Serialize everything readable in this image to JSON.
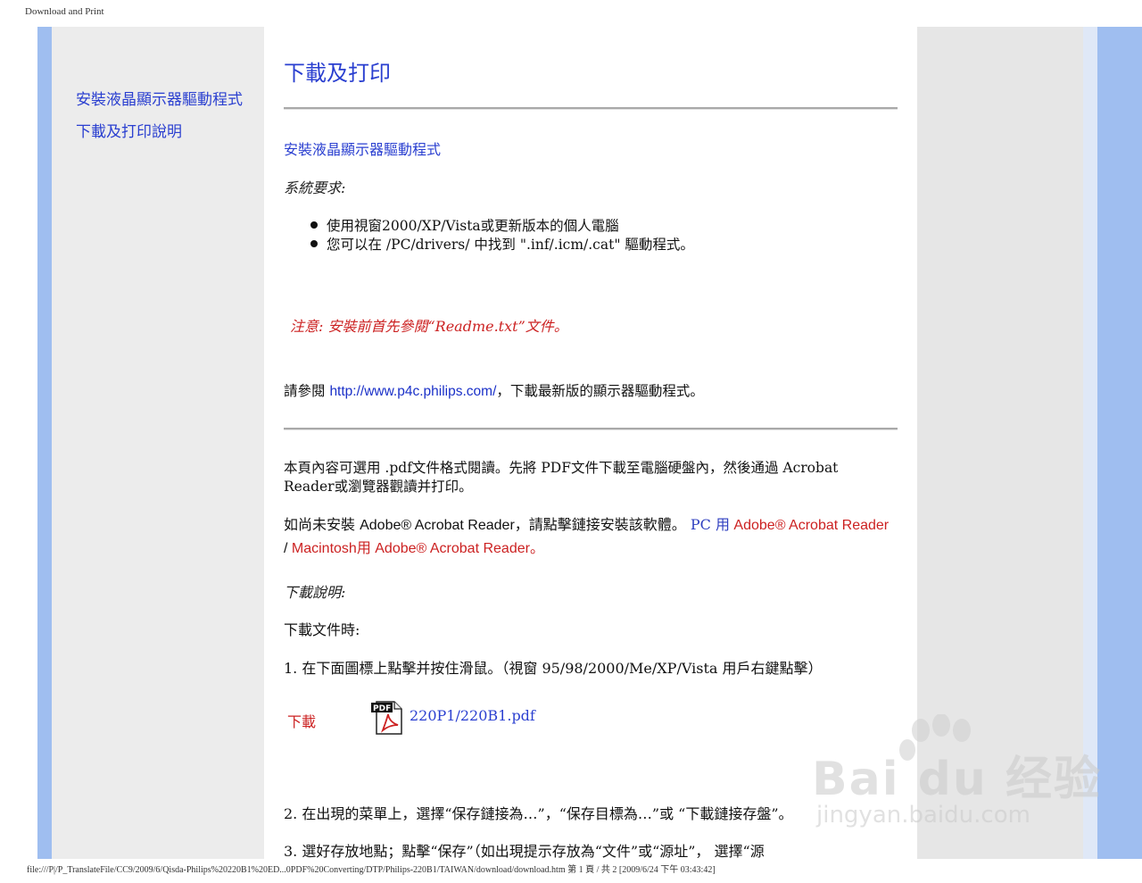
{
  "header": {
    "title": "Download and Print"
  },
  "sidebar": {
    "items": [
      {
        "label": "安裝液晶顯示器驅動程式"
      },
      {
        "label": "下載及打印說明"
      }
    ]
  },
  "main": {
    "title": "下載及打印",
    "driver_section_title": "安裝液晶顯示器驅動程式",
    "system_req_label": "系統要求:",
    "requirements": [
      "使用視窗2000/XP/Vista或更新版本的個人電腦",
      "您可以在 /PC/drivers/ 中找到 \".inf/.icm/.cat\" 驅動程式。"
    ],
    "note": "注意: 安裝前首先參閱“Readme.txt”文件。",
    "visit_prefix": "請參閱 ",
    "visit_url": "http://www.p4c.philips.com/",
    "visit_suffix": "，下載最新版的顯示器驅動程式。",
    "pdf_para": "本頁內容可選用 .pdf文件格式閱讀。先將 PDF文件下載至電腦硬盤內，然後通過 Acrobat Reader或瀏覽器觀讀并打印。",
    "acrobat": {
      "prefix": "如尚未安裝 ",
      "product": "Adobe® Acrobat Reader",
      "middle": "，請點擊鏈接安裝該軟體。 ",
      "pc_label": "PC 用",
      "pc_link": " Adobe® Acrobat Reader",
      "sep": " / ",
      "mac_link": "Macintosh用 Adobe® Acrobat Reader",
      "end": "。"
    },
    "download_instr_label": "下載說明:",
    "download_file_label": "下載文件時:",
    "step1": "1. 在下面圖標上點擊并按住滑鼠。（視窗 95/98/2000/Me/XP/Vista 用戶右鍵點擊）",
    "download_label": "下載",
    "pdf_icon_text": "PDF",
    "pdf_file": "220P1/220B1.pdf",
    "step2": "2. 在出現的菜單上，選擇“保存鏈接為…”，“保存目標為…”或 “下載鏈接存盤”。",
    "step3": "3. 選好存放地點；點擊“保存”（如出現提示存放為“文件”或“源址”， 選擇“源"
  },
  "footer": {
    "path": "file:///P|/P_TranslateFile/CC9/2009/6/Qisda-Philips%20220B1%20ED...0PDF%20Converting/DTP/Philips-220B1/TAIWAN/download/download.htm 第 1 頁 / 共 2 [2009/6/24 下午 03:43:42]"
  },
  "watermark": {
    "brand": "Bai du 经验",
    "url": "jingyan.baidu.com"
  },
  "colors": {
    "link_blue": "#2a3fd0",
    "note_red": "#cc2222",
    "side_blue": "#9fbef0",
    "panel_gray": "#ececec"
  }
}
